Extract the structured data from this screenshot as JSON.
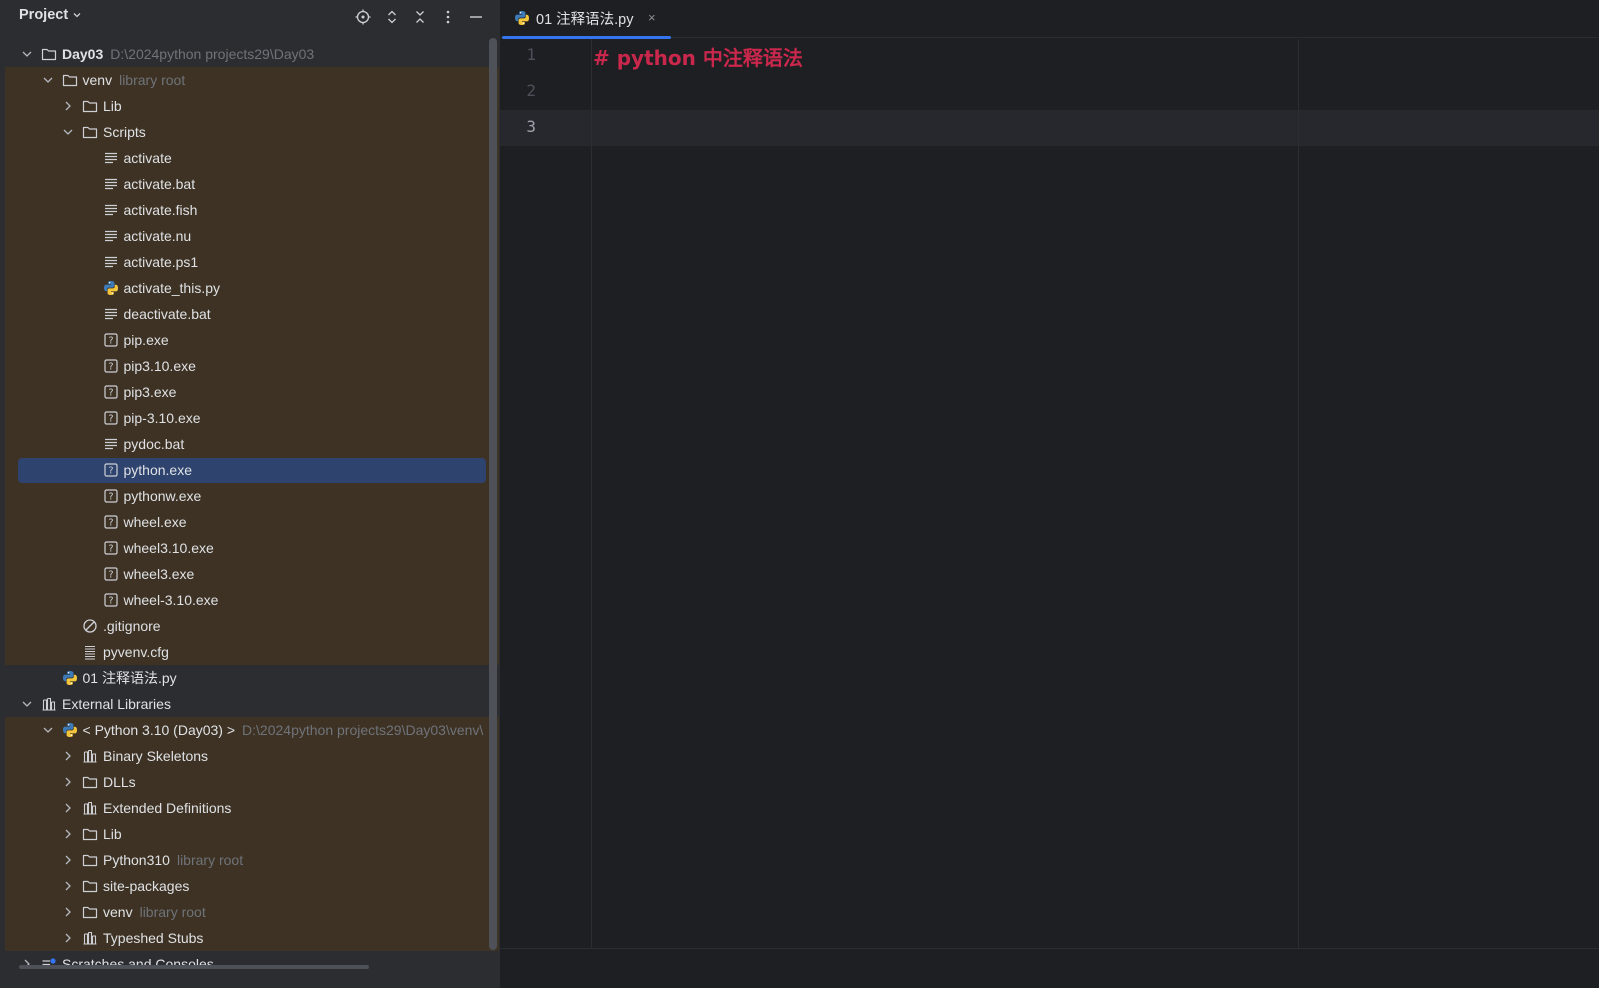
{
  "panel": {
    "title": "Project",
    "toolbar": [
      "locate-icon",
      "expand-all-icon",
      "collapse-all-icon",
      "options-icon",
      "hide-icon"
    ]
  },
  "tree": [
    {
      "label": "Day03",
      "hint": "D:\\2024python projects29\\Day03",
      "icon": "folder",
      "depth": 0,
      "chevron": "down",
      "bold": true
    },
    {
      "label": "venv",
      "hint": "library root",
      "icon": "folder",
      "depth": 1,
      "chevron": "down",
      "excluded": true
    },
    {
      "label": "Lib",
      "hint": "",
      "icon": "folder",
      "depth": 2,
      "chevron": "right",
      "excluded": true
    },
    {
      "label": "Scripts",
      "hint": "",
      "icon": "folder",
      "depth": 2,
      "chevron": "down",
      "excluded": true
    },
    {
      "label": "activate",
      "hint": "",
      "icon": "text",
      "depth": 3,
      "excluded": true
    },
    {
      "label": "activate.bat",
      "hint": "",
      "icon": "text",
      "depth": 3,
      "excluded": true
    },
    {
      "label": "activate.fish",
      "hint": "",
      "icon": "text",
      "depth": 3,
      "excluded": true
    },
    {
      "label": "activate.nu",
      "hint": "",
      "icon": "text",
      "depth": 3,
      "excluded": true
    },
    {
      "label": "activate.ps1",
      "hint": "",
      "icon": "text",
      "depth": 3,
      "excluded": true
    },
    {
      "label": "activate_this.py",
      "hint": "",
      "icon": "python",
      "depth": 3,
      "excluded": true
    },
    {
      "label": "deactivate.bat",
      "hint": "",
      "icon": "text",
      "depth": 3,
      "excluded": true
    },
    {
      "label": "pip.exe",
      "hint": "",
      "icon": "unknown",
      "depth": 3,
      "excluded": true
    },
    {
      "label": "pip3.10.exe",
      "hint": "",
      "icon": "unknown",
      "depth": 3,
      "excluded": true
    },
    {
      "label": "pip3.exe",
      "hint": "",
      "icon": "unknown",
      "depth": 3,
      "excluded": true
    },
    {
      "label": "pip-3.10.exe",
      "hint": "",
      "icon": "unknown",
      "depth": 3,
      "excluded": true
    },
    {
      "label": "pydoc.bat",
      "hint": "",
      "icon": "text",
      "depth": 3,
      "excluded": true
    },
    {
      "label": "python.exe",
      "hint": "",
      "icon": "unknown",
      "depth": 3,
      "excluded": true,
      "selected": true
    },
    {
      "label": "pythonw.exe",
      "hint": "",
      "icon": "unknown",
      "depth": 3,
      "excluded": true
    },
    {
      "label": "wheel.exe",
      "hint": "",
      "icon": "unknown",
      "depth": 3,
      "excluded": true
    },
    {
      "label": "wheel3.10.exe",
      "hint": "",
      "icon": "unknown",
      "depth": 3,
      "excluded": true
    },
    {
      "label": "wheel3.exe",
      "hint": "",
      "icon": "unknown",
      "depth": 3,
      "excluded": true
    },
    {
      "label": "wheel-3.10.exe",
      "hint": "",
      "icon": "unknown",
      "depth": 3,
      "excluded": true
    },
    {
      "label": ".gitignore",
      "hint": "",
      "icon": "ignore",
      "depth": 2,
      "excluded": true
    },
    {
      "label": "pyvenv.cfg",
      "hint": "",
      "icon": "config",
      "depth": 2,
      "excluded": true
    },
    {
      "label": "01  注释语法.py",
      "hint": "",
      "icon": "python",
      "depth": 1
    },
    {
      "label": "External Libraries",
      "hint": "",
      "icon": "library",
      "depth": 0,
      "chevron": "down"
    },
    {
      "label": "< Python 3.10 (Day03) >",
      "hint": "D:\\2024python projects29\\Day03\\venv\\",
      "icon": "python",
      "depth": 1,
      "chevron": "down",
      "excluded": true
    },
    {
      "label": "Binary Skeletons",
      "hint": "",
      "icon": "library",
      "depth": 2,
      "chevron": "right",
      "excluded": true
    },
    {
      "label": "DLLs",
      "hint": "",
      "icon": "folder",
      "depth": 2,
      "chevron": "right",
      "excluded": true
    },
    {
      "label": "Extended Definitions",
      "hint": "",
      "icon": "library",
      "depth": 2,
      "chevron": "right",
      "excluded": true
    },
    {
      "label": "Lib",
      "hint": "",
      "icon": "folder",
      "depth": 2,
      "chevron": "right",
      "excluded": true
    },
    {
      "label": "Python310",
      "hint": "library root",
      "icon": "folder",
      "depth": 2,
      "chevron": "right",
      "excluded": true
    },
    {
      "label": "site-packages",
      "hint": "",
      "icon": "folder",
      "depth": 2,
      "chevron": "right",
      "excluded": true
    },
    {
      "label": "venv",
      "hint": "library root",
      "icon": "folder",
      "depth": 2,
      "chevron": "right",
      "excluded": true
    },
    {
      "label": "Typeshed Stubs",
      "hint": "",
      "icon": "library",
      "depth": 2,
      "chevron": "right",
      "excluded": true
    },
    {
      "label": "Scratches and Consoles",
      "hint": "",
      "icon": "scratch",
      "depth": 0,
      "chevron": "right"
    }
  ],
  "editor": {
    "tab_label": "01  注释语法.py",
    "tab_close": "×",
    "line_numbers": [
      "1",
      "2",
      "3"
    ],
    "active_line": 3,
    "code": [
      "# python 中注释语法",
      "",
      ""
    ]
  },
  "colors": {
    "accent": "#3574f0",
    "selection": "#2e436e",
    "excluded_bg": "#3d3223",
    "comment": "#c9284c"
  }
}
